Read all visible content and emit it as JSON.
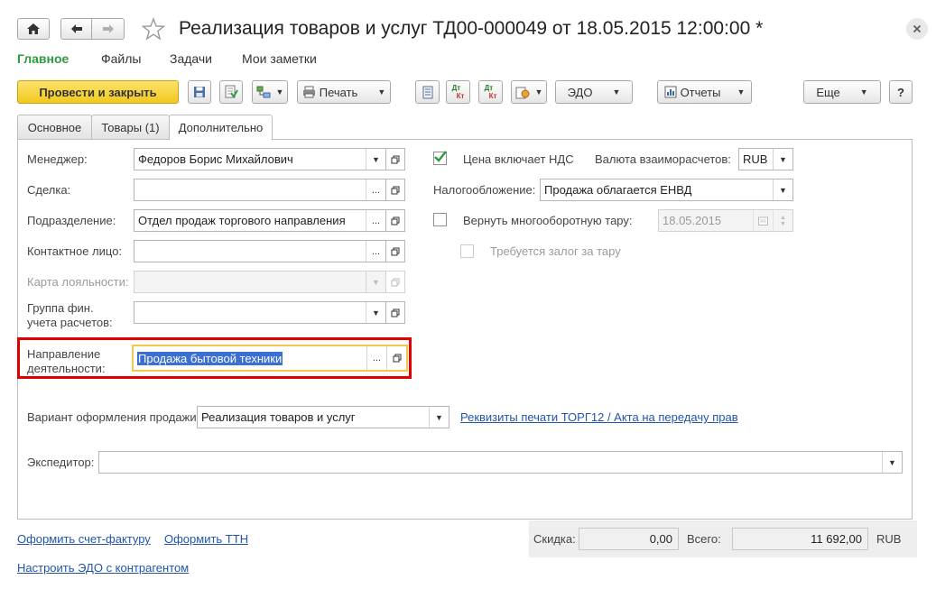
{
  "header": {
    "title": "Реализация товаров и услуг ТД00-000049 от 18.05.2015 12:00:00 *"
  },
  "nav": {
    "items": [
      "Главное",
      "Файлы",
      "Задачи",
      "Мои заметки"
    ]
  },
  "toolbar": {
    "post_close_label": "Провести и закрыть",
    "print_label": "Печать",
    "edo_label": "ЭДО",
    "reports_label": "Отчеты",
    "more_label": "Еще",
    "help_label": "?",
    "dt_label": "Дт",
    "kt_label": "Кт"
  },
  "tabs": [
    "Основное",
    "Товары (1)",
    "Дополнительно"
  ],
  "form": {
    "manager": {
      "label": "Менеджер:",
      "value": "Федоров Борис Михайлович"
    },
    "deal": {
      "label": "Сделка:",
      "value": ""
    },
    "department": {
      "label": "Подразделение:",
      "value": "Отдел продаж торгового направления"
    },
    "contact": {
      "label": "Контактное лицо:",
      "value": ""
    },
    "loyalty": {
      "label": "Карта лояльности:",
      "value": ""
    },
    "fin_group": {
      "label_line1": "Группа фин.",
      "label_line2": "учета расчетов:",
      "value": ""
    },
    "direction": {
      "label_line1": "Направление",
      "label_line2": "деятельности:",
      "value": "Продажа бытовой техники"
    },
    "vat_included": {
      "label": "Цена включает НДС",
      "checked": true
    },
    "currency": {
      "label": "Валюта взаиморасчетов:",
      "value": "RUB"
    },
    "taxation": {
      "label": "Налогообложение:",
      "value": "Продажа облагается ЕНВД"
    },
    "return_tare": {
      "label": "Вернуть многооборотную тару:",
      "checked": false,
      "date": "18.05.2015"
    },
    "deposit": {
      "label": "Требуется залог за тару",
      "checked": false
    },
    "sale_variant": {
      "label": "Вариант оформления продажи:",
      "value": "Реализация товаров и услуг"
    },
    "print_requisites_link": "Реквизиты печати ТОРГ12 / Акта на передачу прав",
    "forwarder": {
      "label": "Экспедитор:",
      "value": ""
    }
  },
  "footer": {
    "invoice_link": "Оформить счет-фактуру",
    "ttn_link": "Оформить ТТН",
    "edo_setup_link": "Настроить ЭДО с контрагентом",
    "discount_label": "Скидка:",
    "discount_value": "0,00",
    "total_label": "Всего:",
    "total_value": "11 692,00",
    "currency": "RUB"
  },
  "colors": {
    "accent_green": "#2e9a3e",
    "primary_button": "#f5d130",
    "highlight_red": "#e00000",
    "focus_yellow": "#f2c94c",
    "link_blue": "#2255aa"
  },
  "icons": [
    "home-icon",
    "back-icon",
    "forward-icon",
    "star-icon",
    "close-icon",
    "save-icon",
    "post-icon",
    "structure-icon",
    "print-icon",
    "list-icon",
    "dt-kt-icon",
    "attachment-icon",
    "reports-icon",
    "open-icon",
    "calendar-icon",
    "check-icon"
  ]
}
